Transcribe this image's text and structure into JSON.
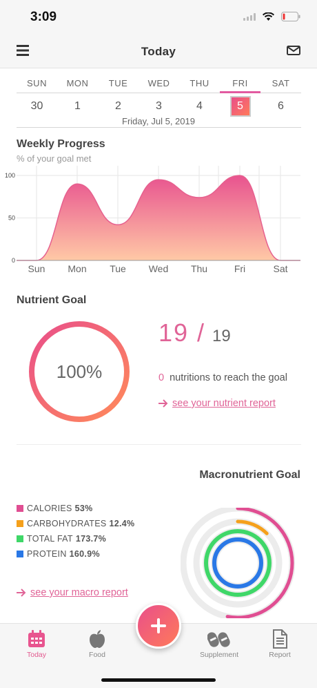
{
  "status": {
    "time": "3:09"
  },
  "nav": {
    "title": "Today"
  },
  "week": {
    "days": [
      "SUN",
      "MON",
      "TUE",
      "WED",
      "THU",
      "FRI",
      "SAT"
    ],
    "dates": [
      "30",
      "1",
      "2",
      "3",
      "4",
      "5",
      "6"
    ],
    "selected_index": 5,
    "full_date": "Friday, Jul 5, 2019"
  },
  "weekly": {
    "title": "Weekly Progress",
    "subtitle": "% of your goal met"
  },
  "chart_data": {
    "type": "area",
    "categories": [
      "Sun",
      "Mon",
      "Tue",
      "Wed",
      "Thu",
      "Fri",
      "Sat"
    ],
    "values": [
      0,
      90,
      42,
      95,
      74,
      100,
      0
    ],
    "yticks": [
      "100",
      "50",
      "0"
    ],
    "ylim": [
      0,
      100
    ],
    "grid": true,
    "colors": {
      "top": "#e8538f",
      "bottom": "#ffc9a6",
      "stroke": "#e6608e"
    }
  },
  "nutrient": {
    "title": "Nutrient Goal",
    "percent_label": "100%",
    "met": "19 /",
    "total": "19",
    "remaining": "0",
    "remaining_text": "nutritions to reach the goal",
    "report_link": "see your nutrient report"
  },
  "macro": {
    "title": "Macronutrient Goal",
    "legend": [
      {
        "name": "CALORIES",
        "value": "53%",
        "color": "#e04e92",
        "pct": 53
      },
      {
        "name": "CARBOHYDRATES",
        "value": "12.4%",
        "color": "#f5a01b",
        "pct": 12.4
      },
      {
        "name": "TOTAL FAT",
        "value": "173.7%",
        "color": "#3fd768",
        "pct": 100
      },
      {
        "name": "PROTEIN",
        "value": "160.9%",
        "color": "#2a78e6",
        "pct": 100
      }
    ],
    "report_link": "see your macro report"
  },
  "tabs": [
    {
      "label": "Today",
      "icon": "calendar-icon"
    },
    {
      "label": "Food",
      "icon": "apple-icon"
    },
    {
      "label": "Supplement",
      "icon": "pill-icon"
    },
    {
      "label": "Report",
      "icon": "document-icon"
    }
  ],
  "fab": {
    "icon": "plus-icon"
  }
}
